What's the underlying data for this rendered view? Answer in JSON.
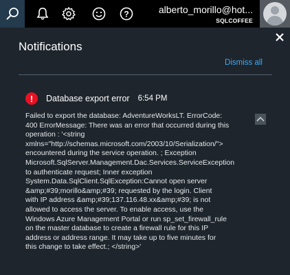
{
  "topbar": {
    "icons": [
      "search-icon",
      "bell-icon",
      "gear-icon",
      "smiley-icon",
      "help-icon"
    ],
    "active_icon": "search-icon",
    "active_color": "#243a4d"
  },
  "user": {
    "name": "alberto_morillo@hot...",
    "org": "SQLCOFFEE"
  },
  "notifications": {
    "title": "Notifications",
    "dismiss_all": "Dismiss all",
    "items": [
      {
        "icon": "error-icon",
        "title": "Database export error",
        "time": "6:54 PM",
        "body": "Failed to export the database: AdventureWorksLT. ErrorCode:\n400 ErrorMessage: There was an error that occurred during this\noperation : '<string\nxmlns=\"http://schemas.microsoft.com/2003/10/Serialization/\">\nencountered during the service operation. ; Exception\nMicrosoft.SqlServer.Management.Dac.Services.ServiceException\nto authenticate request; Inner exception\nSystem.Data.SqlClient.SqlException:Cannot open server\n&amp;#39;morillo&amp;#39; requested by the login. Client\nwith IP address &amp;#39;137.116.48.xx&amp;#39; is not\nallowed to access the server. To enable access, use the\nWindows Azure Management Portal or run sp_set_firewall_rule\non the master database to create a firewall rule for this IP\naddress or address range. It may take up to five minutes for\nthis change to take effect.; </string>'"
      }
    ]
  },
  "colors": {
    "accent_link": "#3fa9f5",
    "error": "#e81123",
    "panel_bg": "#1e252c",
    "topbar_bg": "#000000"
  }
}
